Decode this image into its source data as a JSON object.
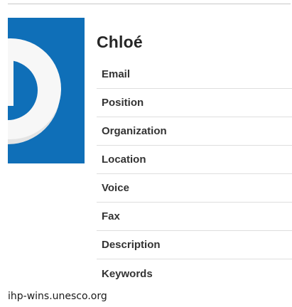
{
  "profile": {
    "name": "Chloé",
    "avatar_icon": "blue-d-logo",
    "avatar_color": "#0f6fb8"
  },
  "fields": [
    {
      "label": "Email"
    },
    {
      "label": "Position"
    },
    {
      "label": "Organization"
    },
    {
      "label": "Location"
    },
    {
      "label": "Voice"
    },
    {
      "label": "Fax"
    },
    {
      "label": "Description"
    },
    {
      "label": "Keywords"
    }
  ],
  "footer": {
    "source": "ihp-wins.unesco.org"
  }
}
